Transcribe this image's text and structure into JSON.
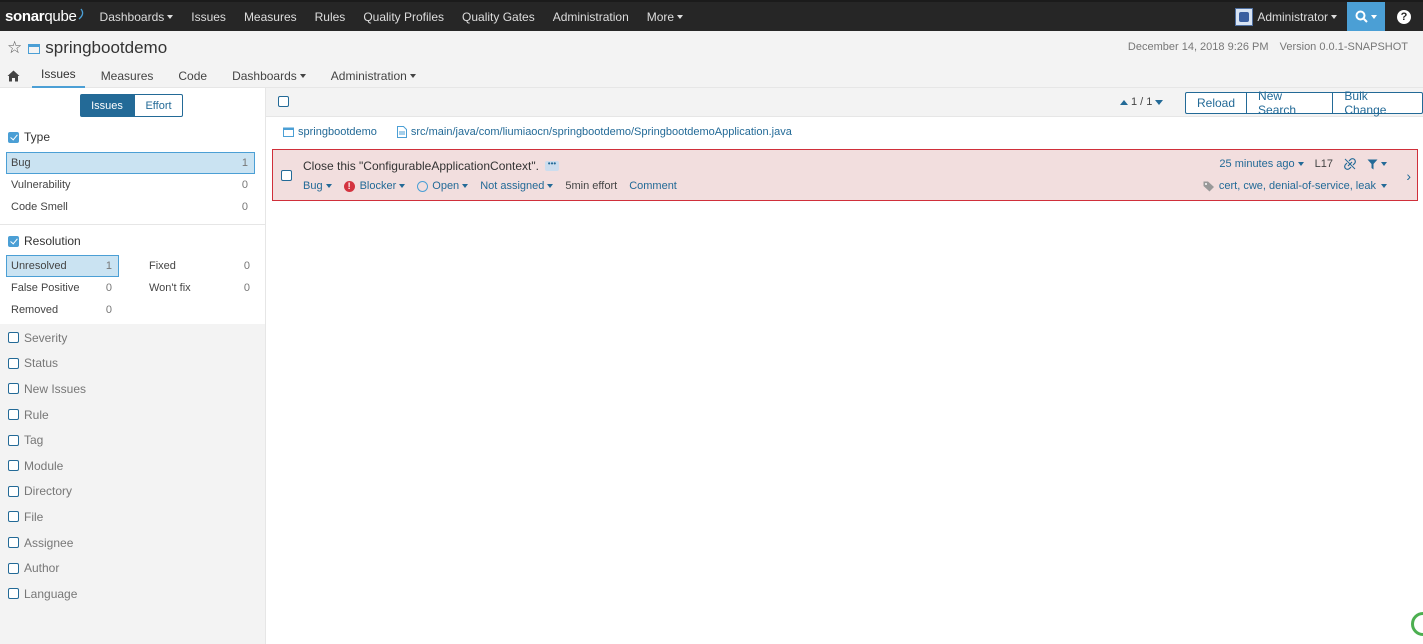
{
  "topnav": {
    "logo_bold": "sonar",
    "logo_rest": "qube",
    "items": [
      "Dashboards",
      "Issues",
      "Measures",
      "Rules",
      "Quality Profiles",
      "Quality Gates",
      "Administration",
      "More"
    ],
    "user": "Administrator"
  },
  "context": {
    "project_name": "springbootdemo",
    "date": "December 14, 2018 9:26 PM",
    "version": "Version 0.0.1-SNAPSHOT",
    "tabs": [
      "Issues",
      "Measures",
      "Code",
      "Dashboards",
      "Administration"
    ]
  },
  "sidebar": {
    "mode": {
      "issues": "Issues",
      "effort": "Effort"
    },
    "type": {
      "title": "Type",
      "items": [
        {
          "label": "Bug",
          "count": "1"
        },
        {
          "label": "Vulnerability",
          "count": "0"
        },
        {
          "label": "Code Smell",
          "count": "0"
        }
      ]
    },
    "resolution": {
      "title": "Resolution",
      "items": [
        {
          "label": "Unresolved",
          "count": "1"
        },
        {
          "label": "Fixed",
          "count": "0"
        },
        {
          "label": "False Positive",
          "count": "0"
        },
        {
          "label": "Won't fix",
          "count": "0"
        },
        {
          "label": "Removed",
          "count": "0"
        }
      ]
    },
    "collapsed": [
      "Severity",
      "Status",
      "New Issues",
      "Rule",
      "Tag",
      "Module",
      "Directory",
      "File",
      "Assignee",
      "Author",
      "Language"
    ]
  },
  "toolbar": {
    "paging": "1 / 1",
    "reload": "Reload",
    "new_search": "New Search",
    "bulk_change": "Bulk Change"
  },
  "breadcrumb": {
    "project": "springbootdemo",
    "file": "src/main/java/com/liumiaocn/springbootdemo/SpringbootdemoApplication.java"
  },
  "issue": {
    "message": "Close this \"ConfigurableApplicationContext\".",
    "type": "Bug",
    "severity": "Blocker",
    "status": "Open",
    "assignee": "Not assigned",
    "effort": "5min effort",
    "comment": "Comment",
    "age": "25 minutes ago",
    "line": "L17",
    "tags": "cert, cwe, denial-of-service, leak"
  },
  "colors": {
    "accent": "#236a97",
    "highlight": "#4b9fd5",
    "error": "#d02f3a",
    "issue_bg": "#f2dede"
  }
}
